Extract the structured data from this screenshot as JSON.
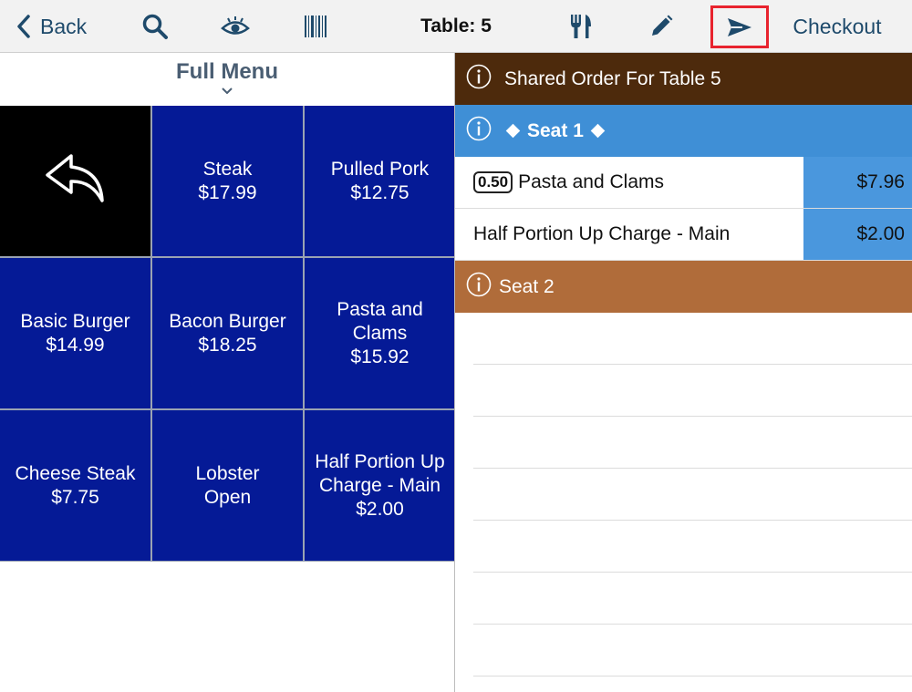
{
  "toolbar": {
    "back_label": "Back",
    "table_label": "Table: 5",
    "checkout_label": "Checkout",
    "icons": [
      "chevron-left-icon",
      "search-icon",
      "eye-icon",
      "barcode-icon",
      "utensils-icon",
      "pencil-icon",
      "send-icon"
    ],
    "accent": "#1e4a6b",
    "highlight": "#e8232e"
  },
  "menu": {
    "title": "Full Menu",
    "tile_color": "#051a96",
    "items": [
      {
        "line1": "Steak",
        "line2": "$17.99",
        "line3": ""
      },
      {
        "line1": "Pulled Pork",
        "line2": "$12.75",
        "line3": ""
      },
      {
        "line1": "Basic Burger",
        "line2": "$14.99",
        "line3": ""
      },
      {
        "line1": "Bacon Burger",
        "line2": "$18.25",
        "line3": ""
      },
      {
        "line1": "Pasta and",
        "line2": "Clams",
        "line3": "$15.92"
      },
      {
        "line1": "Cheese Steak",
        "line2": "$7.75",
        "line3": ""
      },
      {
        "line1": "Lobster",
        "line2": "Open",
        "line3": ""
      },
      {
        "line1": "Half Portion Up",
        "line2": "Charge - Main",
        "line3": "$2.00"
      }
    ]
  },
  "order": {
    "shared_label": "Shared Order For Table 5",
    "seat1_label": "Seat 1",
    "seat2_label": "Seat 2",
    "items": [
      {
        "qty": "0.50",
        "name": "Pasta and Clams",
        "price": "$7.96"
      },
      {
        "qty": "",
        "name": "Half Portion Up Charge - Main",
        "price": "$2.00"
      }
    ],
    "colors": {
      "shared": "#4d2a0c",
      "seat1": "#3f8fd6",
      "seat2": "#b06c3a",
      "price_cell": "#4a97dd"
    }
  }
}
